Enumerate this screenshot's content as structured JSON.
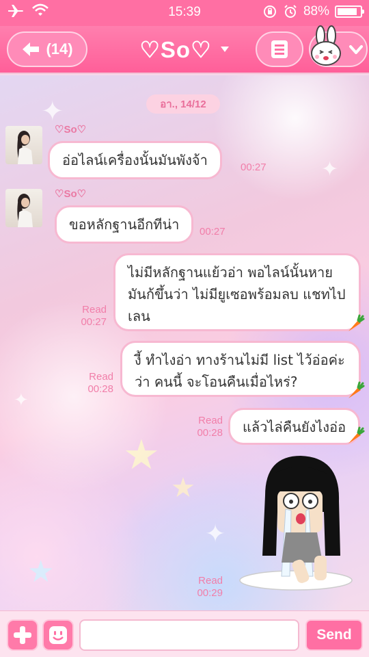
{
  "status_bar": {
    "time": "15:39",
    "battery_percent": "88%",
    "battery_level": 0.88
  },
  "header": {
    "back_label": "(14)",
    "title": "♡So♡"
  },
  "chat": {
    "date": "อา., 14/12",
    "incoming": [
      {
        "sender": "♡So♡",
        "text": "อ่อไลน์เครื่องนั้นมันพังจ้า",
        "time": "00:27"
      },
      {
        "sender": "♡So♡",
        "text": "ขอหลักฐานอีกทีน่า",
        "time": "00:27"
      }
    ],
    "outgoing": [
      {
        "read": "Read",
        "time": "00:27",
        "text": "ไม่มีหลักฐานแย้วอ่า พอไลน์นั้นหาย\nมันก้ขึ้นว่า ไม่มียูเซอพร้อมลบ แชทไป\nเลน"
      },
      {
        "read": "Read",
        "time": "00:28",
        "text": "งี้ ทำไงอ่า ทางร้านไม่มี list ไว้อ่อค่ะ\nว่า คนนี้ จะโอนคืนเมื่อไหร่?"
      },
      {
        "read": "Read",
        "time": "00:28",
        "text": "แล้วไล่คืนยังไงอ่อ"
      }
    ],
    "sticker": {
      "read": "Read",
      "time": "00:29"
    }
  },
  "input_bar": {
    "placeholder": "",
    "send_label": "Send"
  },
  "colors": {
    "header_pink": "#ff6fa3",
    "bubble_border": "#f7b8d1",
    "timestamp_pink": "#f17ea9"
  }
}
